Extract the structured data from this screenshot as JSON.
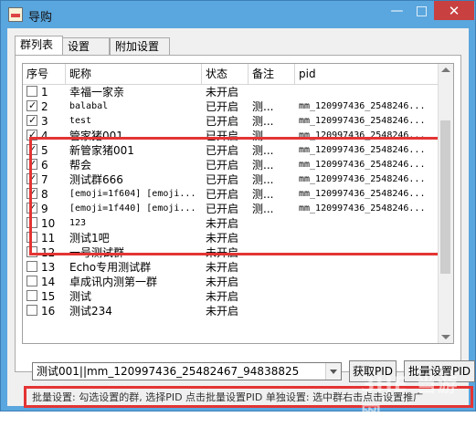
{
  "window": {
    "title": "导购",
    "minimize_label": "—",
    "maximize_label": "□",
    "close_label": "✕"
  },
  "tabs": [
    {
      "label": "群列表",
      "active": true
    },
    {
      "label": "设置",
      "active": false
    },
    {
      "label": "附加设置",
      "active": false
    }
  ],
  "table": {
    "columns": [
      "序号",
      "昵称",
      "状态",
      "备注",
      "pid"
    ],
    "rows": [
      {
        "checked": false,
        "num": "1",
        "nickname": "幸福一家亲",
        "status": "未开启",
        "remark": "",
        "pid": ""
      },
      {
        "checked": true,
        "num": "2",
        "nickname": "balabal",
        "status": "已开启",
        "remark": "测...",
        "pid": "mm_120997436_2548246..."
      },
      {
        "checked": true,
        "num": "3",
        "nickname": "test",
        "status": "已开启",
        "remark": "测...",
        "pid": "mm_120997436_2548246..."
      },
      {
        "checked": true,
        "num": "4",
        "nickname": "管家猪001",
        "status": "已开启",
        "remark": "测...",
        "pid": "mm_120997436_2548246..."
      },
      {
        "checked": true,
        "num": "5",
        "nickname": "新管家猪001",
        "status": "已开启",
        "remark": "测...",
        "pid": "mm_120997436_2548246..."
      },
      {
        "checked": true,
        "num": "6",
        "nickname": "帮会",
        "status": "已开启",
        "remark": "测...",
        "pid": "mm_120997436_2548246..."
      },
      {
        "checked": true,
        "num": "7",
        "nickname": "测试群666",
        "status": "已开启",
        "remark": "测...",
        "pid": "mm_120997436_2548246..."
      },
      {
        "checked": true,
        "num": "8",
        "nickname": "[emoji=1f604] [emoji...",
        "status": "已开启",
        "remark": "测...",
        "pid": "mm_120997436_2548246..."
      },
      {
        "checked": true,
        "num": "9",
        "nickname": "[emoji=1f440] [emoji...",
        "status": "已开启",
        "remark": "测...",
        "pid": "mm_120997436_2548246..."
      },
      {
        "checked": false,
        "num": "10",
        "nickname": "123",
        "status": "未开启",
        "remark": "",
        "pid": ""
      },
      {
        "checked": false,
        "num": "11",
        "nickname": "测试1吧",
        "status": "未开启",
        "remark": "",
        "pid": ""
      },
      {
        "checked": false,
        "num": "12",
        "nickname": "一号测试群",
        "status": "未开启",
        "remark": "",
        "pid": ""
      },
      {
        "checked": false,
        "num": "13",
        "nickname": "Echo专用测试群",
        "status": "未开启",
        "remark": "",
        "pid": ""
      },
      {
        "checked": false,
        "num": "14",
        "nickname": "卓成讯内测第一群",
        "status": "未开启",
        "remark": "",
        "pid": ""
      },
      {
        "checked": false,
        "num": "15",
        "nickname": "测试",
        "status": "未开启",
        "remark": "",
        "pid": ""
      },
      {
        "checked": false,
        "num": "16",
        "nickname": "测试234",
        "status": "未开启",
        "remark": "",
        "pid": ""
      }
    ]
  },
  "controls": {
    "pid_combo_value": "测试001||mm_120997436_25482467_94838825",
    "get_pid_button": "获取PID",
    "batch_pid_button": "批量设置PID"
  },
  "instruction": "批量设置: 勾选设置的群, 选择PID 点击批量设置PID 单独设置: 选中群右击点击设置推广",
  "watermark": "3HE 当游网",
  "colors": {
    "title_bar": "#5aa6de",
    "close_button": "#c84040",
    "highlight_red": "#e43434"
  }
}
